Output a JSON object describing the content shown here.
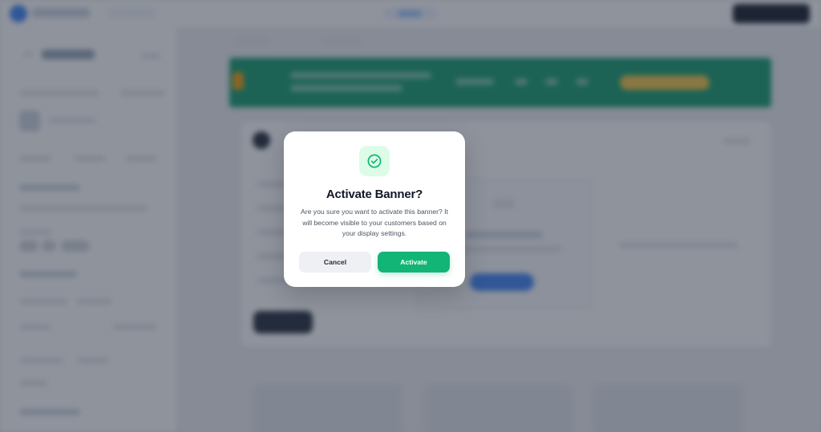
{
  "modal": {
    "title": "Activate Banner?",
    "message": "Are you sure you want to activate this banner? It will become visible to your customers based on your display settings.",
    "icon": "check-circle-icon",
    "cancel_label": "Cancel",
    "confirm_label": "Activate"
  },
  "colors": {
    "primary_green": "#12b576",
    "banner_green": "#0f9b6c",
    "icon_bg": "#dcfce7",
    "overlay": "rgba(40,48,66,0.52)"
  }
}
